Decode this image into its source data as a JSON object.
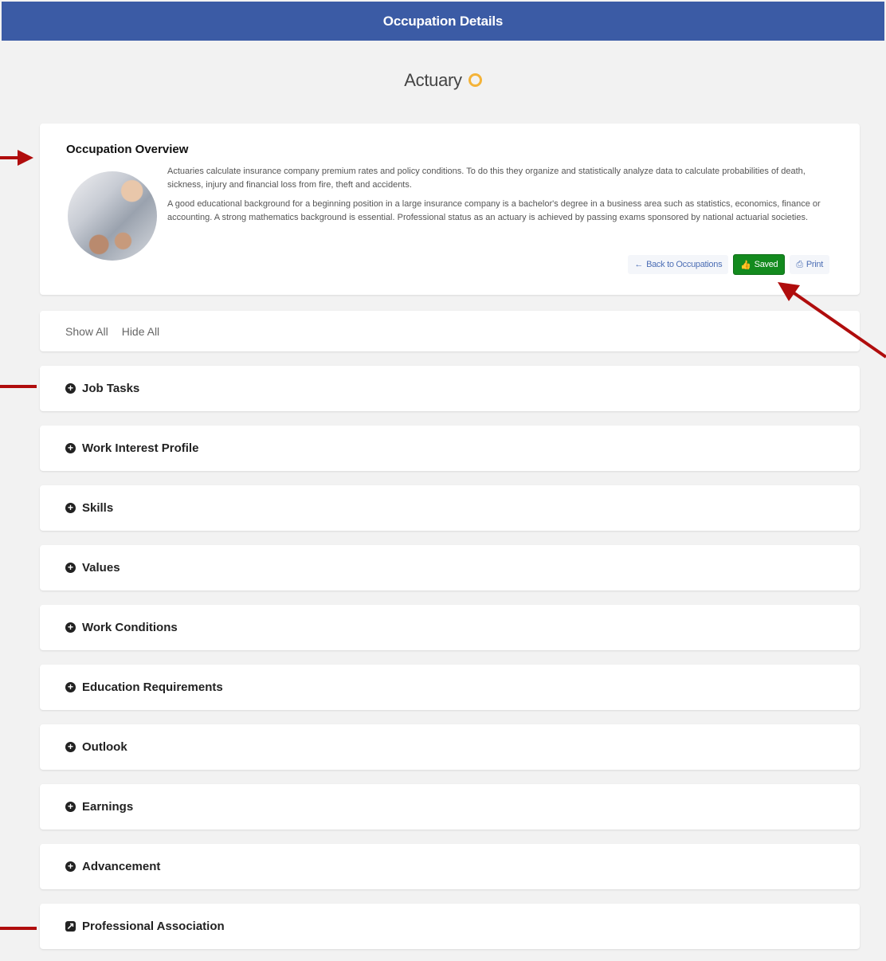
{
  "header": {
    "title": "Occupation Details"
  },
  "occupation": {
    "name": "Actuary"
  },
  "overview": {
    "heading": "Occupation Overview",
    "paragraph1": "Actuaries calculate insurance company premium rates and policy conditions. To do this they organize and statistically analyze data to calculate probabilities of death, sickness, injury and financial loss from fire, theft and accidents.",
    "paragraph2": "A good educational background for a beginning position in a large insurance company is a bachelor's degree in a business area such as statistics, economics, finance or accounting. A strong mathematics background is essential. Professional status as an actuary is achieved by passing exams sponsored by national actuarial societies.",
    "buttons": {
      "back": "Back to Occupations",
      "saved": "Saved",
      "print": "Print"
    }
  },
  "toggles": {
    "show_all": "Show All",
    "hide_all": "Hide All"
  },
  "sections": [
    {
      "label": "Job Tasks"
    },
    {
      "label": "Work Interest Profile"
    },
    {
      "label": "Skills"
    },
    {
      "label": "Values"
    },
    {
      "label": "Work Conditions"
    },
    {
      "label": "Education Requirements"
    },
    {
      "label": "Outlook"
    },
    {
      "label": "Earnings"
    },
    {
      "label": "Advancement"
    },
    {
      "label": "Professional Association"
    }
  ],
  "colors": {
    "header": "#3b5ba5",
    "saved": "#138a1e",
    "annotation": "#b00d0d",
    "favorite": "#f4b338"
  }
}
